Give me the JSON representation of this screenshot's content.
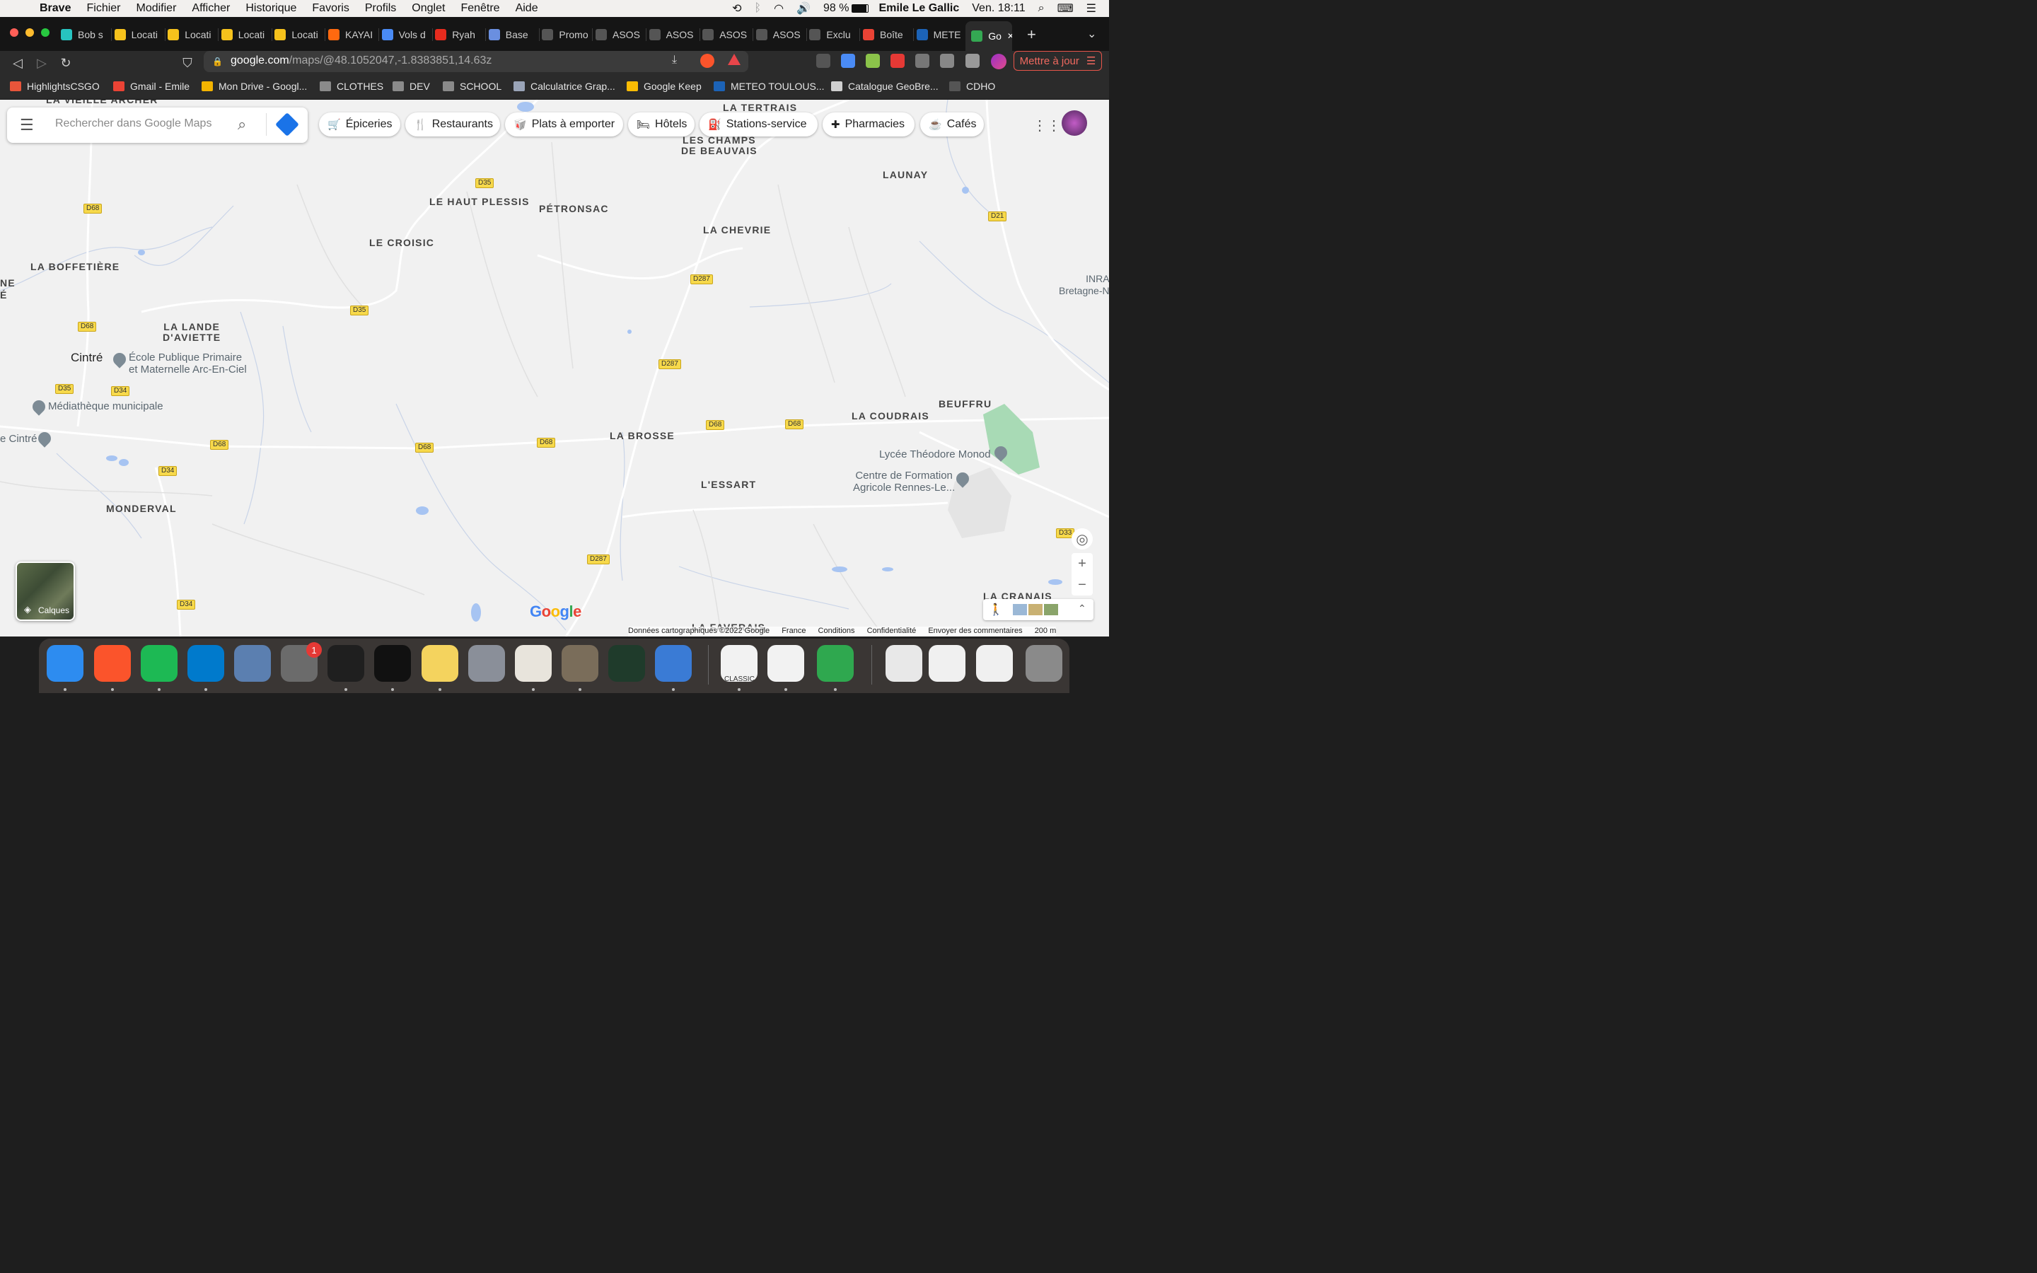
{
  "menubar": {
    "app_name": "Brave",
    "menus": [
      "Fichier",
      "Modifier",
      "Afficher",
      "Historique",
      "Favoris",
      "Profils",
      "Onglet",
      "Fenêtre",
      "Aide"
    ],
    "battery": "98 %",
    "user": "Emile Le Gallic",
    "clock": "Ven. 18:11"
  },
  "tabs": [
    {
      "label": "Bob s",
      "color": "#27c3c0"
    },
    {
      "label": "Locati",
      "color": "#f6c21c"
    },
    {
      "label": "Locati",
      "color": "#f6c21c"
    },
    {
      "label": "Locati",
      "color": "#f6c21c"
    },
    {
      "label": "Locati",
      "color": "#f6c21c"
    },
    {
      "label": "KAYAI",
      "color": "#ff690f"
    },
    {
      "label": "Vols d",
      "color": "#4a8bf5"
    },
    {
      "label": "Ryah",
      "color": "#e62b1e"
    },
    {
      "label": "Base",
      "color": "#6a8fe0"
    },
    {
      "label": "Promo",
      "color": "#555555"
    },
    {
      "label": "ASOS",
      "color": "#555555"
    },
    {
      "label": "ASOS",
      "color": "#555555"
    },
    {
      "label": "ASOS",
      "color": "#555555"
    },
    {
      "label": "ASOS",
      "color": "#555555"
    },
    {
      "label": "Exclu",
      "color": "#555555"
    },
    {
      "label": "Boîte",
      "color": "#ea4335"
    },
    {
      "label": "METE",
      "color": "#1c63b7"
    },
    {
      "label": "Go",
      "color": "#34a853",
      "active": true
    }
  ],
  "address": {
    "host": "google.com",
    "path": "/maps/@48.1052047,-1.8383851,14.63z",
    "update_label": "Mettre à jour"
  },
  "bookmarks": [
    {
      "label": "HighlightsCSGO",
      "color": "#e8553a"
    },
    {
      "label": "Gmail - Emile",
      "color": "#ea4335"
    },
    {
      "label": "Mon Drive - Googl...",
      "color": "#f4b400"
    },
    {
      "label": "CLOTHES",
      "color": "#8a8a8a"
    },
    {
      "label": "DEV",
      "color": "#8a8a8a"
    },
    {
      "label": "SCHOOL",
      "color": "#8a8a8a"
    },
    {
      "label": "Calculatrice Grap...",
      "color": "#9aa4b8"
    },
    {
      "label": "Google Keep",
      "color": "#fbbc04"
    },
    {
      "label": "METEO TOULOUS...",
      "color": "#1c63b7"
    },
    {
      "label": "Catalogue GeoBre...",
      "color": "#cfcfcf"
    },
    {
      "label": "CDHO",
      "color": "#555555"
    }
  ],
  "maps": {
    "search_placeholder": "Rechercher dans Google Maps",
    "chips": [
      {
        "label": "Épiceries",
        "icon": "cart-icon",
        "glyph": "🛒"
      },
      {
        "label": "Restaurants",
        "icon": "fork-knife-icon",
        "glyph": "🍴"
      },
      {
        "label": "Plats à emporter",
        "icon": "takeout-icon",
        "glyph": "🥡"
      },
      {
        "label": "Hôtels",
        "icon": "bed-icon",
        "glyph": "🛏"
      },
      {
        "label": "Stations-service",
        "icon": "fuel-icon",
        "glyph": "⛽"
      },
      {
        "label": "Pharmacies",
        "icon": "pharmacy-icon",
        "glyph": "✚"
      },
      {
        "label": "Cafés",
        "icon": "coffee-icon",
        "glyph": "☕"
      }
    ],
    "places": {
      "la_vieille_archer": "LA VIEILLE ARCHER",
      "le_haut_plessis": "LE HAUT PLESSIS",
      "petronsac": "PÉTRONSAC",
      "le_croisic": "LE CROISIC",
      "la_tertrais": "LA TERTRAIS",
      "les_champs_de_beauvais": "LES CHAMPS\nDE BEAUVAIS",
      "launay": "LAUNAY",
      "la_chevrie": "LA CHEVRIE",
      "la_boffetiere": "LA BOFFETIÈRE",
      "la_lande_daviette": "LA LANDE\nD'AVIETTE",
      "la_brosse": "LA BROSSE",
      "la_coudrais": "LA COUDRAIS",
      "beuffru": "BEUFFRU",
      "lessart": "L'ESSART",
      "monderval": "MONDERVAL",
      "la_cranais": "LA CRANAIS",
      "la_faverais": "LA FAVERAIS",
      "ne_edge": "NE\nÉ",
      "inra": "INRA\nBretagne-N"
    },
    "town": "Cintré",
    "pois": {
      "ecole": "École Publique Primaire\net Maternelle Arc-En-Ciel",
      "mediatheque": "Médiathèque municipale",
      "e_cintre": "e Cintré",
      "lycee": "Lycée Théodore Monod",
      "centre": "Centre de Formation\nAgricole Rennes-Le..."
    },
    "roads": [
      "D68",
      "D35",
      "D34",
      "D287",
      "D21",
      "D33"
    ],
    "layers_label": "Calques",
    "attribution": [
      "Données cartographiques ©2022 Google",
      "France",
      "Conditions",
      "Confidentialité",
      "Envoyer des commentaires",
      "200 m"
    ]
  },
  "dock": {
    "apps": [
      "Finder",
      "Brave",
      "Spotify",
      "Visual Studio Code",
      "Mail",
      "Préférences Système",
      "Terminal",
      "Terminal",
      "Notes",
      "Launchpad",
      "Script Editor",
      "GIMP",
      "Moniteur d'activité",
      "Keynote",
      "GeoGebra Classic",
      "GeoGebra",
      "Numbers",
      "Document",
      "Capture",
      "Capture",
      "Corbeille"
    ],
    "badge": "1",
    "classic_label": "CLASSIC"
  }
}
